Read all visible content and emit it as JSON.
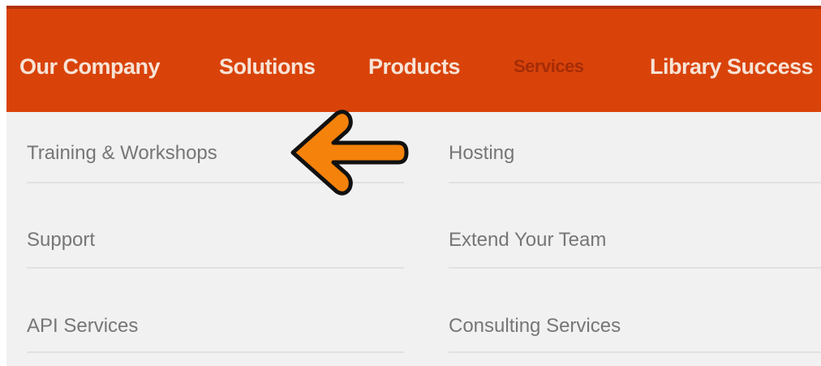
{
  "nav": {
    "items": [
      {
        "label": "Our Company",
        "active": false
      },
      {
        "label": "Solutions",
        "active": false
      },
      {
        "label": "Products",
        "active": false
      },
      {
        "label": "Services",
        "active": true
      },
      {
        "label": "Library Success",
        "active": false
      }
    ]
  },
  "dropdown": {
    "left_column": [
      {
        "label": "Training & Workshops"
      },
      {
        "label": "Support"
      },
      {
        "label": "API Services"
      }
    ],
    "right_column": [
      {
        "label": "Hosting"
      },
      {
        "label": "Extend Your Team"
      },
      {
        "label": "Consulting Services"
      }
    ]
  },
  "annotation": {
    "arrow_icon": "left-arrow-icon",
    "arrow_fill": "#f5820b",
    "arrow_outline": "#111111"
  },
  "colors": {
    "nav_background": "#d9430a",
    "dropdown_background": "#f1f1f1"
  }
}
